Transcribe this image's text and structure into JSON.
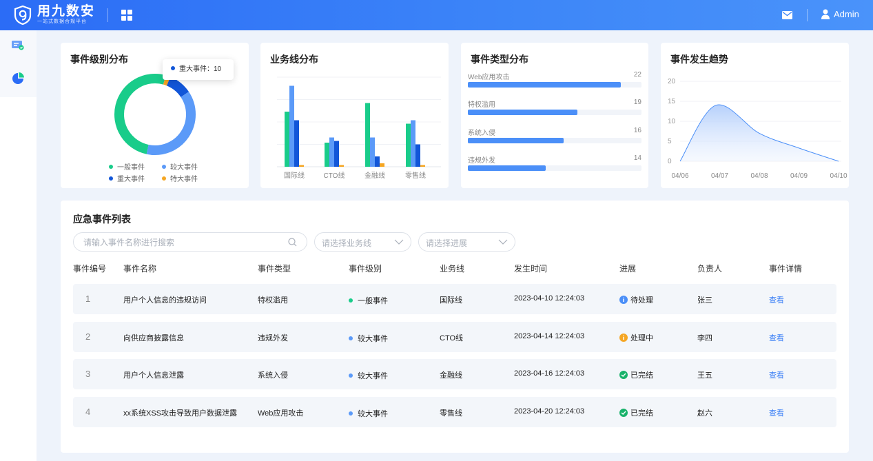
{
  "header": {
    "brand": "用九数安",
    "brand_sub": "一站式数据合规平台",
    "user": "Admin"
  },
  "cards": {
    "level": {
      "title": "事件级别分布",
      "tooltip": "重大事件：10",
      "legend": [
        {
          "label": "一般事件",
          "color": "#19cc8a"
        },
        {
          "label": "较大事件",
          "color": "#5b9af8"
        },
        {
          "label": "重大事件",
          "color": "#1256d8"
        },
        {
          "label": "特大事件",
          "color": "#f5a623"
        }
      ]
    },
    "business": {
      "title": "业务线分布"
    },
    "types": {
      "title": "事件类型分布",
      "items": [
        {
          "name": "Web应用攻击",
          "value": "22",
          "ratio": 0.88
        },
        {
          "name": "特权滥用",
          "value": "19",
          "ratio": 0.63
        },
        {
          "name": "系统入侵",
          "value": "16",
          "ratio": 0.55
        },
        {
          "name": "违规外发",
          "value": "14",
          "ratio": 0.45
        }
      ]
    },
    "trend": {
      "title": "事件发生趋势"
    }
  },
  "chart_data": [
    {
      "type": "pie",
      "title": "事件级别分布",
      "labels": [
        "一般事件",
        "较大事件",
        "重大事件",
        "特大事件"
      ],
      "values": [
        54,
        40,
        10,
        2
      ],
      "colors": [
        "#19cc8a",
        "#5b9af8",
        "#1256d8",
        "#f5a623"
      ]
    },
    {
      "type": "bar",
      "title": "业务线分布",
      "categories": [
        "国际线",
        "CTO线",
        "金融线",
        "零售线"
      ],
      "series": [
        {
          "values": [
            16,
            7,
            18.5,
            12.5
          ],
          "color": "#19cc8a"
        },
        {
          "values": [
            23.5,
            8.5,
            8.5,
            13.5
          ],
          "color": "#5b9af8"
        },
        {
          "values": [
            13.5,
            7.5,
            3,
            6.5
          ],
          "color": "#1256d8"
        },
        {
          "values": [
            0.5,
            0.5,
            1,
            0.5
          ],
          "color": "#f5a623"
        }
      ],
      "ylim": [
        0,
        26
      ]
    },
    {
      "type": "area",
      "title": "事件发生趋势",
      "x": [
        "04/06",
        "04/07",
        "04/08",
        "04/09",
        "04/10"
      ],
      "points": [
        [
          0,
          0
        ],
        [
          0.9,
          14
        ],
        [
          2,
          7
        ],
        [
          3,
          3.3
        ],
        [
          4,
          0
        ]
      ],
      "yticks": [
        0,
        5,
        10,
        15,
        20
      ],
      "ylim": [
        0,
        20
      ]
    }
  ],
  "list": {
    "title": "应急事件列表",
    "search_placeholder": "请输入事件名称进行搜索",
    "business_placeholder": "请选择业务线",
    "progress_placeholder": "请选择进展",
    "headers": [
      "事件编号",
      "事件名称",
      "事件类型",
      "事件级别",
      "业务线",
      "发生时间",
      "进展",
      "负责人",
      "事件详情"
    ],
    "rows": [
      {
        "id": "1",
        "name": "用户个人信息的违规访问",
        "type": "特权滥用",
        "level": "一般事件",
        "level_color": "#19cc8a",
        "biz": "国际线",
        "time": "2023-04-10 12:24:03",
        "status": "待处理",
        "status_color": "#4b8ff8",
        "owner": "张三",
        "detail": "查看"
      },
      {
        "id": "2",
        "name": "向供应商披露信息",
        "type": "违规外发",
        "level": "较大事件",
        "level_color": "#5b9af8",
        "biz": "CTO线",
        "time": "2023-04-14 12:24:03",
        "status": "处理中",
        "status_color": "#f5a623",
        "owner": "李四",
        "detail": "查看"
      },
      {
        "id": "3",
        "name": "用户个人信息泄露",
        "type": "系统入侵",
        "level": "较大事件",
        "level_color": "#5b9af8",
        "biz": "金融线",
        "time": "2023-04-16 12:24:03",
        "status": "已完结",
        "status_color": "#19b26b",
        "owner": "王五",
        "detail": "查看"
      },
      {
        "id": "4",
        "name": "xx系统XSS攻击导致用户数据泄露",
        "type": "Web应用攻击",
        "level": "较大事件",
        "level_color": "#5b9af8",
        "biz": "零售线",
        "time": "2023-04-20 12:24:03",
        "status": "已完结",
        "status_color": "#19b26b",
        "owner": "赵六",
        "detail": "查看"
      }
    ]
  }
}
